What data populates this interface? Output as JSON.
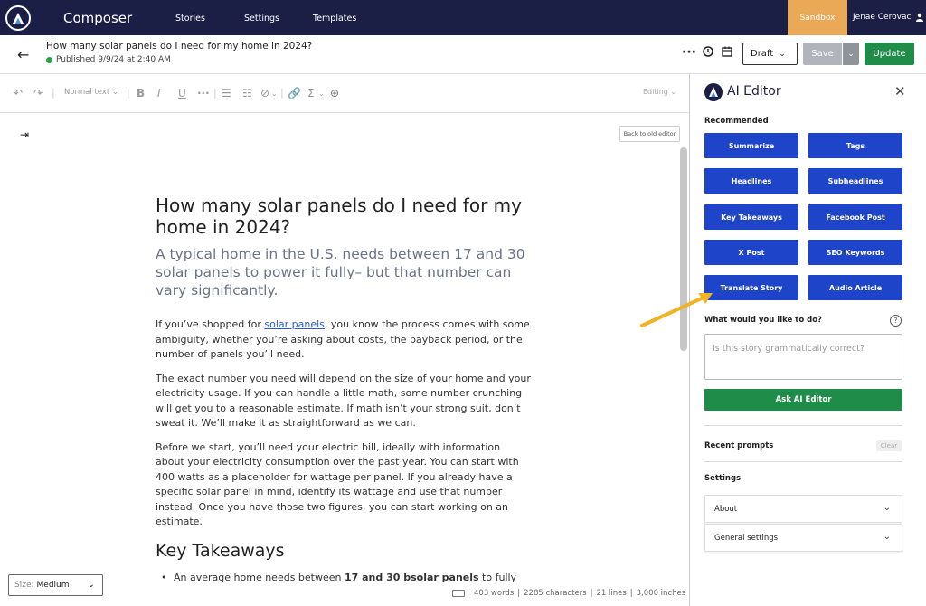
{
  "nav": {
    "app_name": "Composer",
    "links": [
      "Stories",
      "Settings",
      "Templates"
    ],
    "sandbox": "Sandbox",
    "user_name": "Jenae Cerovac"
  },
  "story": {
    "title": "How many solar panels do I need for my home in 2024?",
    "published": "Published 9/9/24 at 2:40 AM",
    "status": "Draft",
    "save_label": "Save",
    "update_label": "Update"
  },
  "toolbar": {
    "text_style": "Normal text",
    "mode": "Editing"
  },
  "editor": {
    "back_to_old": "Back to old editor",
    "headline": "How many solar panels do I need for my home in 2024?",
    "subheadline": "A typical home in the U.S. needs between 17 and 30 solar panels to power it fully– but that number can vary significantly.",
    "p1_before": "If you’ve shopped for ",
    "p1_link": "solar panels",
    "p1_after": ", you know the process comes with some ambiguity, whether you’re asking about costs, the payback period, or the number of panels you’ll need.",
    "p2": "The exact number you need will depend on the size of your home and your electricity usage. If you can handle a little math, some number crunching will get you to a reasonable estimate. If math isn’t your strong suit, don’t sweat it. We’ll make it as straightforward as we can.",
    "p3": "Before we start, you’ll need your electric bill, ideally with information about your electricity consumption over the past year. You can start with 400 watts as a placeholder for wattage per panel. If you already have a specific solar panel in mind, identify its wattage and use that number instead. Once you have those two figures, you can start working on an estimate.",
    "h2": "Key Takeaways",
    "bullet_before": "An average home needs between ",
    "bullet_bold": "17 and 30 bsolar panels",
    "bullet_after": " to fully",
    "size_label": "Size:",
    "size_value": "Medium",
    "stats": {
      "words": "403 words",
      "characters": "2285 characters",
      "lines": "21 lines",
      "inches": "3,000 inches"
    }
  },
  "ai_editor": {
    "title": "AI Editor",
    "recommended_label": "Recommended",
    "buttons": [
      "Summarize",
      "Tags",
      "Headlines",
      "Subheadlines",
      "Key Takeaways",
      "Facebook Post",
      "X Post",
      "SEO Keywords",
      "Translate Story",
      "Audio Article"
    ],
    "ask_label": "What would you like to do?",
    "prompt_placeholder": "Is this story grammatically correct?",
    "ask_button": "Ask AI Editor",
    "recent_label": "Recent prompts",
    "clear_label": "Clear",
    "settings_label": "Settings",
    "accordions": [
      "About",
      "General settings"
    ]
  },
  "colors": {
    "nav_bg": "#1c1f45",
    "sandbox": "#e9a957",
    "ai_button": "#1e44c9",
    "green": "#1f8c4a",
    "annotation_arrow": "#f0b323"
  }
}
